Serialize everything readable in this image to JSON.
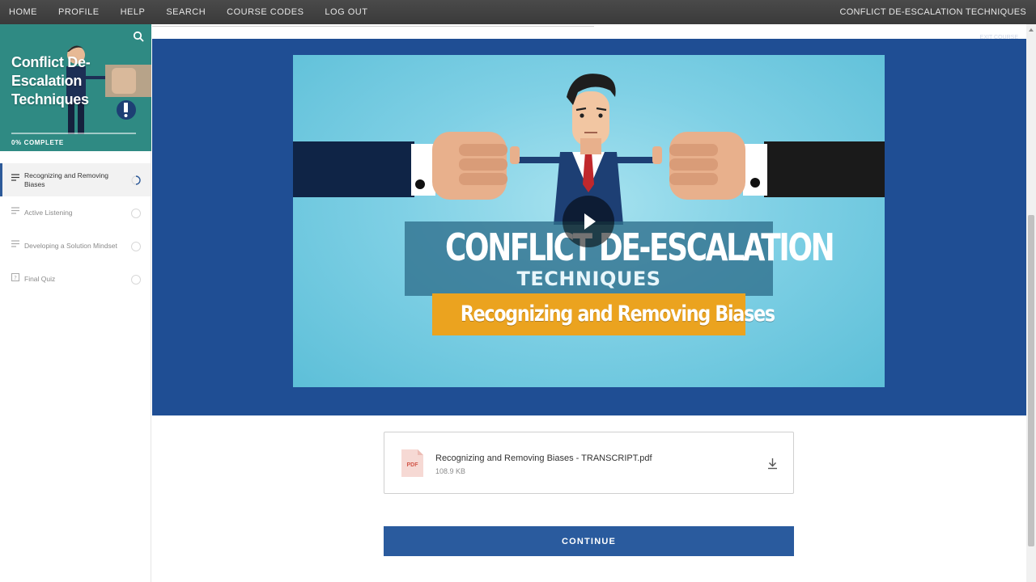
{
  "topnav": {
    "items": [
      "HOME",
      "PROFILE",
      "HELP",
      "SEARCH",
      "COURSE CODES",
      "LOG OUT"
    ],
    "course_title": "CONFLICT DE-ESCALATION TECHNIQUES"
  },
  "sidebar": {
    "hero_title": "Conflict De-Escalation Techniques",
    "progress_label": "0% COMPLETE",
    "progress_fraction": 0,
    "lessons": [
      {
        "label": "Recognizing and Removing Biases",
        "icon": "text-lines-icon",
        "active": true,
        "status": "in-progress"
      },
      {
        "label": "Active Listening",
        "icon": "text-lines-icon",
        "active": false,
        "status": "not-started"
      },
      {
        "label": "Developing a Solution Mindset",
        "icon": "text-lines-icon",
        "active": false,
        "status": "not-started"
      },
      {
        "label": "Final Quiz",
        "icon": "quiz-icon",
        "active": false,
        "status": "not-started"
      }
    ]
  },
  "main": {
    "exit_label": "EXIT COURSE",
    "video": {
      "title_main": "CONFLICT DE-ESCALATION",
      "title_sub": "TECHNIQUES",
      "topic": "Recognizing and Removing Biases"
    },
    "attachment": {
      "file_name": "Recognizing and Removing Biases - TRANSCRIPT.pdf",
      "file_size": "108.9 KB",
      "type_label": "PDF"
    },
    "continue_label": "CONTINUE"
  },
  "colors": {
    "nav_bg": "#404040",
    "video_band": "#1f4e94",
    "accent_blue": "#2a5b9e",
    "topic_banner": "#eba31f",
    "hero_bg": "#2f8a83"
  }
}
